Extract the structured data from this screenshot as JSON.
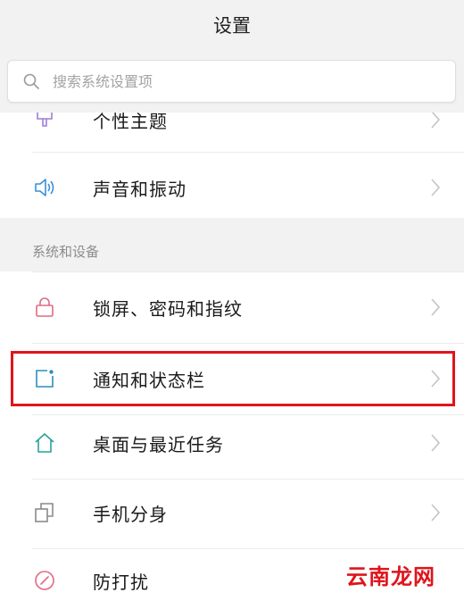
{
  "header": {
    "title": "设置"
  },
  "search": {
    "placeholder": "搜索系统设置项",
    "icon": "search-icon"
  },
  "personal_group": {
    "items": [
      {
        "label": "个性主题",
        "icon": "theme-brush-icon",
        "icon_color": "#9b7ed6"
      },
      {
        "label": "声音和振动",
        "icon": "speaker-icon",
        "icon_color": "#3a8fd9"
      }
    ]
  },
  "system_group": {
    "title": "系统和设备",
    "items": [
      {
        "label": "锁屏、密码和指纹",
        "icon": "lock-icon",
        "icon_color": "#e06a80"
      },
      {
        "label": "通知和状态栏",
        "icon": "notification-icon",
        "icon_color": "#2c8fb8"
      },
      {
        "label": "桌面与最近任务",
        "icon": "home-icon",
        "icon_color": "#27a39a"
      },
      {
        "label": "手机分身",
        "icon": "clone-icon",
        "icon_color": "#8a8a8a"
      },
      {
        "label": "防打扰",
        "icon": "do-not-disturb-icon",
        "icon_color": "#e06a80"
      }
    ]
  },
  "highlight_color": "#e0141b",
  "watermark": {
    "text": "云南龙网"
  }
}
